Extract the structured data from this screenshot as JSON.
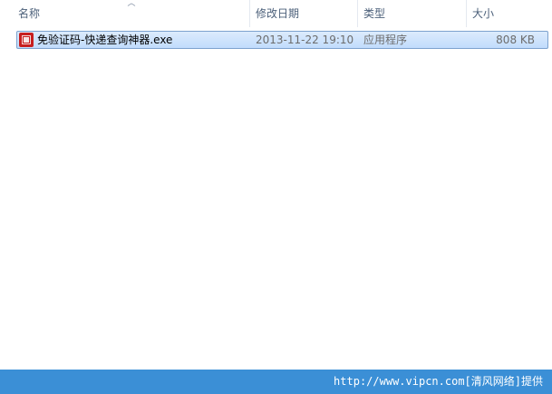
{
  "columns": {
    "name": "名称",
    "date_modified": "修改日期",
    "type": "类型",
    "size": "大小"
  },
  "sort": {
    "column": "name",
    "indicator": "sort-ascending-icon"
  },
  "files": [
    {
      "name": "免验证码-快递查询神器.exe",
      "date_modified": "2013-11-22 19:10",
      "type": "应用程序",
      "size": "808 KB",
      "icon": "app-icon",
      "selected": true
    }
  ],
  "watermark": "http://www.vipcn.com[清风网络]提供",
  "colors": {
    "selection_bg": "#cce0fa",
    "selection_border": "#7da2ce",
    "header_text": "#4c607a",
    "footer_bar": "#3b8fd6"
  }
}
